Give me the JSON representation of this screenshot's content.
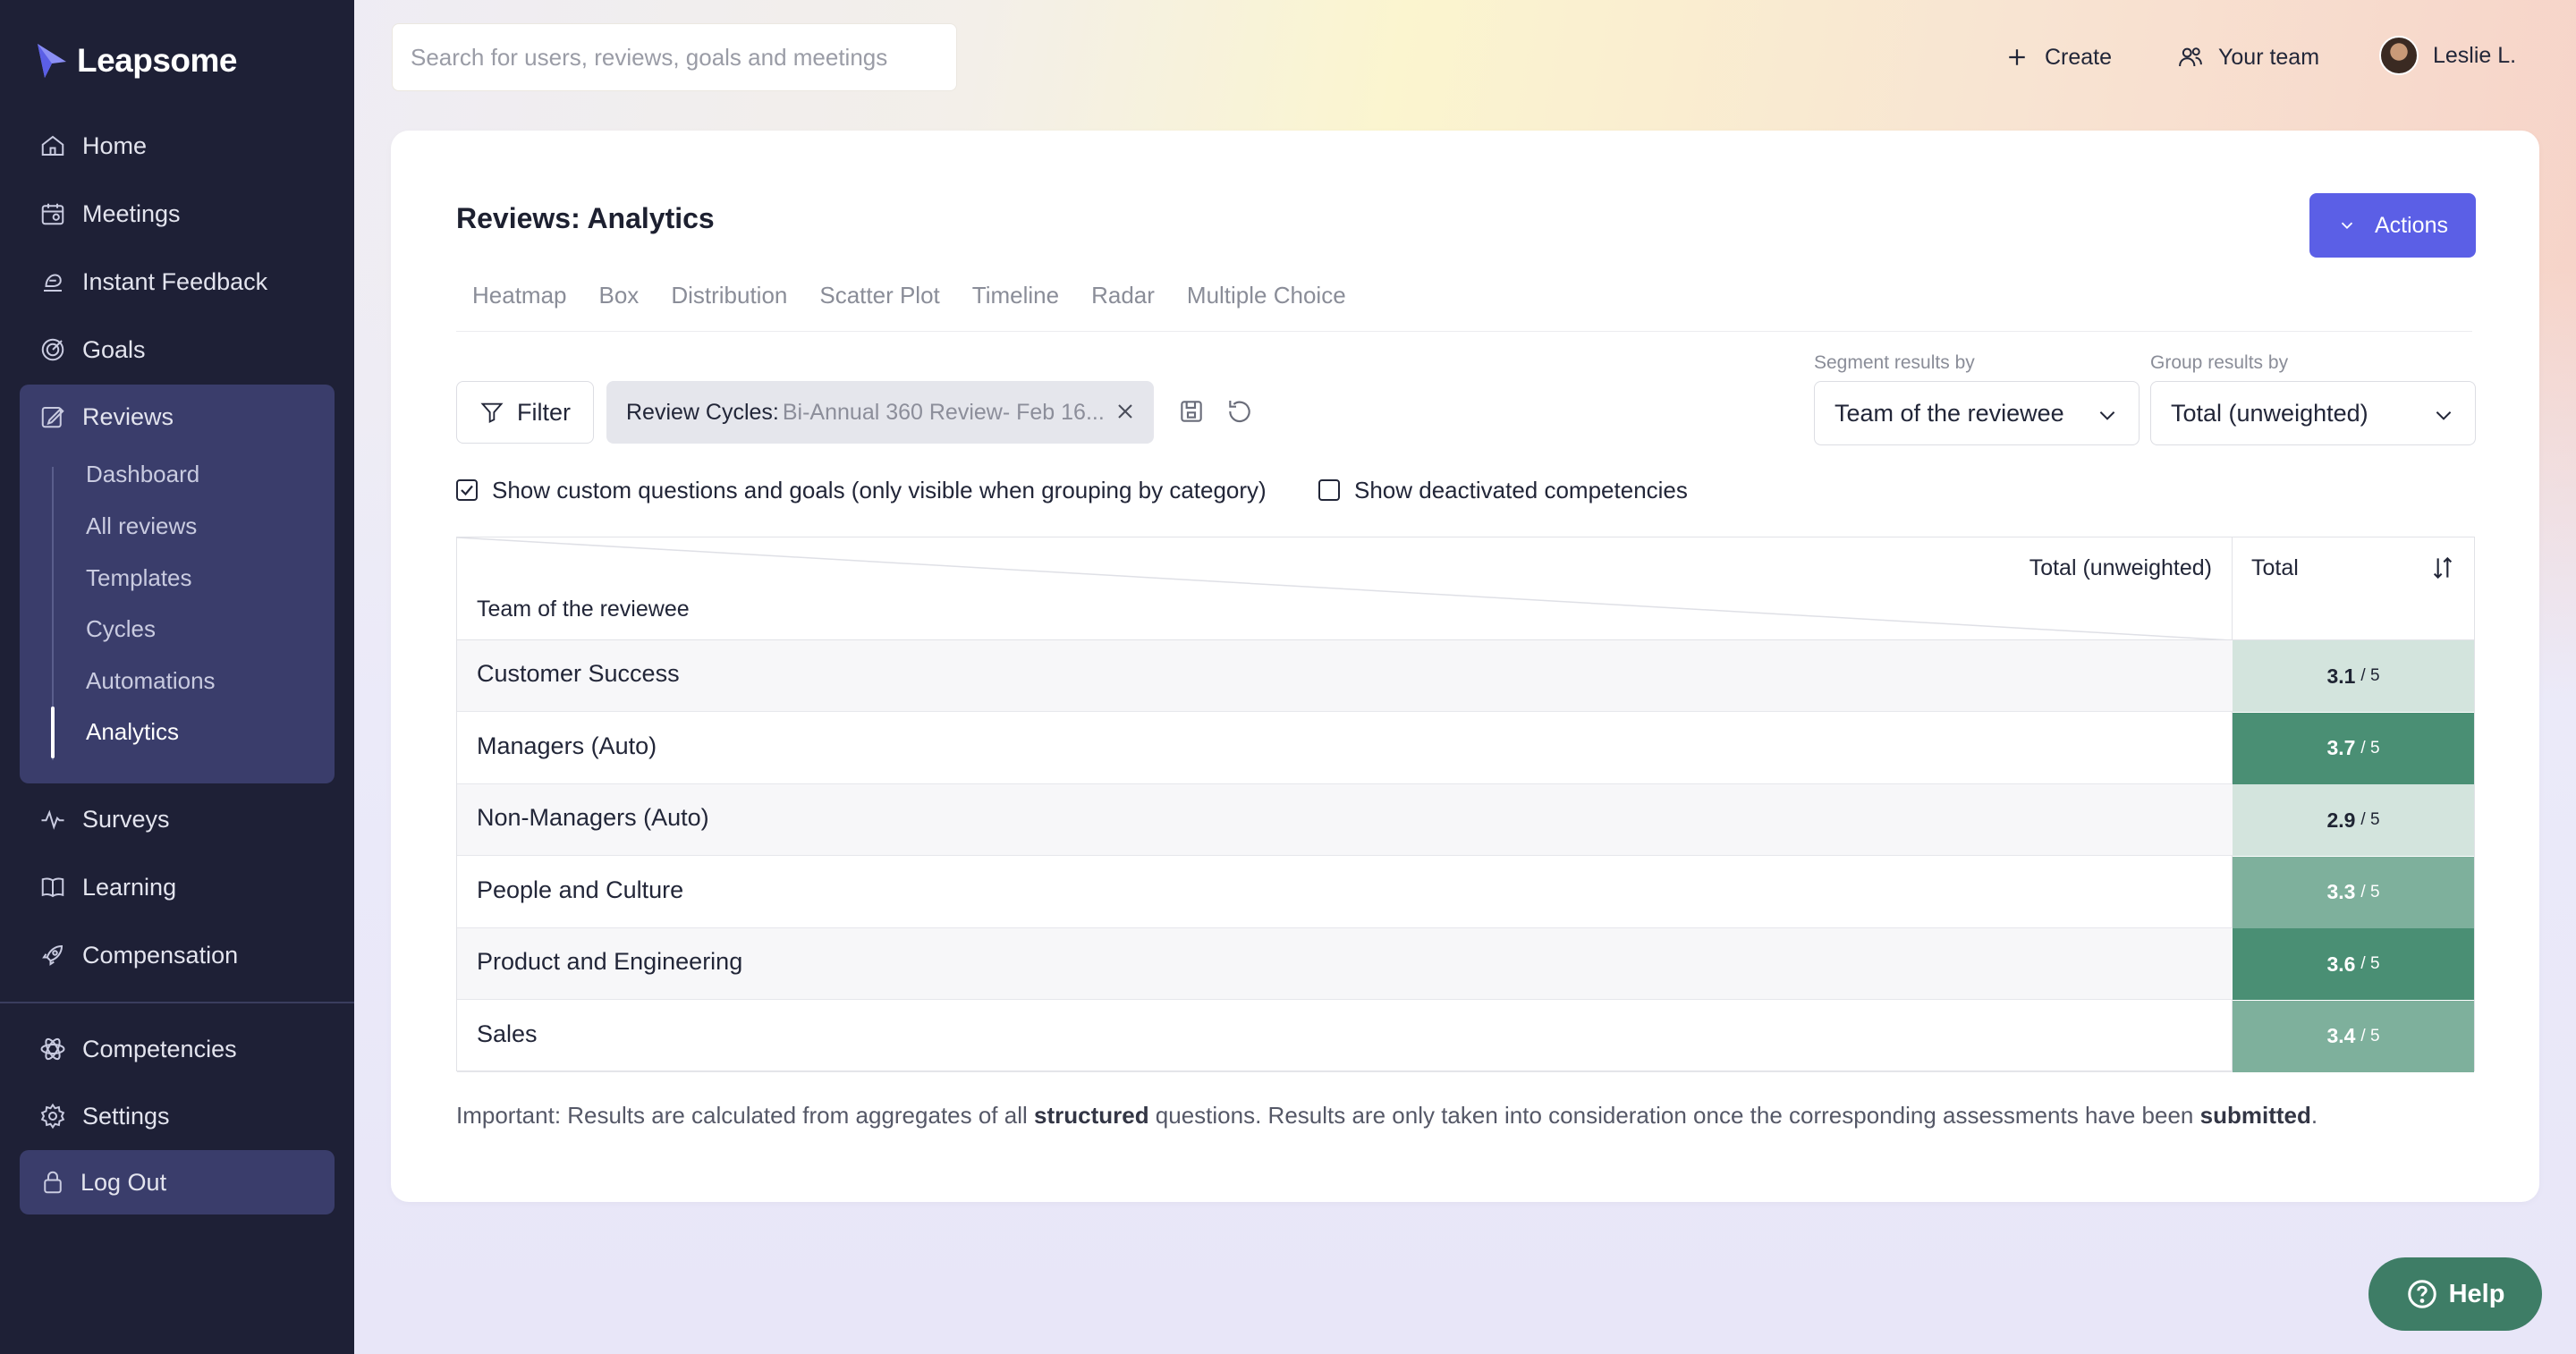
{
  "app": {
    "logo_text": "Leapsome"
  },
  "sidebar": {
    "items": [
      {
        "label": "Home",
        "icon": "home-icon"
      },
      {
        "label": "Meetings",
        "icon": "calendar-icon"
      },
      {
        "label": "Instant Feedback",
        "icon": "feedback-icon"
      },
      {
        "label": "Goals",
        "icon": "target-icon"
      },
      {
        "label": "Reviews",
        "icon": "edit-icon"
      },
      {
        "label": "Surveys",
        "icon": "pulse-icon"
      },
      {
        "label": "Learning",
        "icon": "book-icon"
      },
      {
        "label": "Compensation",
        "icon": "rocket-icon"
      },
      {
        "label": "Competencies",
        "icon": "atom-icon"
      },
      {
        "label": "Settings",
        "icon": "gear-icon"
      }
    ],
    "reviews_sub": [
      "Dashboard",
      "All reviews",
      "Templates",
      "Cycles",
      "Automations",
      "Analytics"
    ],
    "active_sub": "Analytics",
    "logout_label": "Log Out"
  },
  "topbar": {
    "search_placeholder": "Search for users, reviews, goals and meetings",
    "create_label": "Create",
    "team_label": "Your team",
    "user_label": "Leslie L."
  },
  "page": {
    "title": "Reviews: Analytics",
    "actions_label": "Actions",
    "tabs": [
      "Heatmap",
      "Box",
      "Distribution",
      "Scatter Plot",
      "Timeline",
      "Radar",
      "Multiple Choice"
    ]
  },
  "filters": {
    "filter_label": "Filter",
    "chip_key": "Review Cycles:",
    "chip_value": "Bi-Annual 360 Review- Feb 16...",
    "segment_label": "Segment results by",
    "segment_value": "Team of the reviewee",
    "group_label": "Group results by",
    "group_value": "Total (unweighted)"
  },
  "options": {
    "custom_questions_label": "Show custom questions and goals (only visible when grouping by category)",
    "custom_questions_checked": true,
    "deactivated_label": "Show deactivated competencies",
    "deactivated_checked": false
  },
  "table": {
    "header_group": "Total (unweighted)",
    "header_segment": "Team of the reviewee",
    "header_total": "Total",
    "denominator": "/ 5",
    "rows": [
      {
        "team": "Customer Success",
        "score": "3.1",
        "color": "#d3e4dd",
        "text_color": "#1f2433"
      },
      {
        "team": "Managers (Auto)",
        "score": "3.7",
        "color": "#4a8f74",
        "text_color": "#ffffff"
      },
      {
        "team": "Non-Managers (Auto)",
        "score": "2.9",
        "color": "#d3e4dd",
        "text_color": "#1f2433"
      },
      {
        "team": "People and Culture",
        "score": "3.3",
        "color": "#7eb09c",
        "text_color": "#ffffff"
      },
      {
        "team": "Product and Engineering",
        "score": "3.6",
        "color": "#4a8f74",
        "text_color": "#ffffff"
      },
      {
        "team": "Sales",
        "score": "3.4",
        "color": "#7eb09c",
        "text_color": "#ffffff"
      }
    ]
  },
  "note": {
    "part1": "Important: Results are calculated from aggregates of all ",
    "bold1": "structured",
    "part2": " questions. Results are only taken into consideration once the corresponding assessments have been ",
    "bold2": "submitted",
    "part3": "."
  },
  "help_label": "Help",
  "colors": {
    "sidebar_bg": "#1e2036",
    "sidebar_active": "#3a3d6b",
    "accent": "#5b5fe6",
    "help_bg": "#3e7d66"
  }
}
